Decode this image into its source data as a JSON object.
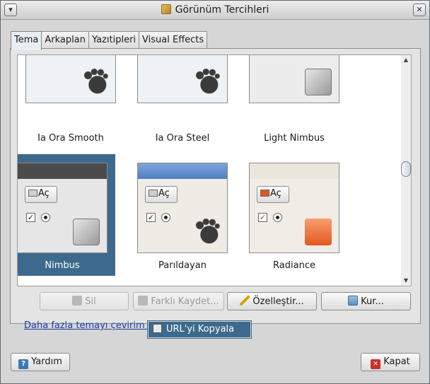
{
  "window": {
    "title": "Görünüm Tercihleri",
    "menu_icon": "window-menu-icon",
    "close_icon": "window-close-icon"
  },
  "tabs": [
    {
      "label": "Tema",
      "active": true
    },
    {
      "label": "Arkaplan",
      "active": false
    },
    {
      "label": "Yazıtipleri",
      "active": false
    },
    {
      "label": "Visual Effects",
      "active": false
    }
  ],
  "themes": [
    {
      "name": "Ia Ora Smooth",
      "icon": "theme-preview-icon",
      "selected": false
    },
    {
      "name": "Ia Ora Steel",
      "icon": "theme-preview-icon",
      "selected": false
    },
    {
      "name": "Light Nimbus",
      "icon": "theme-preview-icon",
      "selected": false
    },
    {
      "name": "Nimbus",
      "icon": "theme-preview-icon",
      "selected": true
    },
    {
      "name": "Parıldayan",
      "icon": "theme-preview-icon",
      "selected": false
    },
    {
      "name": "Radiance",
      "icon": "theme-preview-icon",
      "selected": false
    }
  ],
  "preview": {
    "open_button_label": "Aç"
  },
  "actions": {
    "delete_label": "Sil",
    "save_as_label": "Farklı Kaydet...",
    "customize_label": "Özelleştir...",
    "install_label": "Kur..."
  },
  "more_themes_link": "Daha fazla temayı çevirim iç",
  "context_menu": {
    "copy_url_label": "URL'yi Kopyala"
  },
  "footer": {
    "help_label": "Yardım",
    "close_label": "Kapat"
  },
  "colors": {
    "selection": "#3d6a8c",
    "link": "#1c3fa8"
  }
}
